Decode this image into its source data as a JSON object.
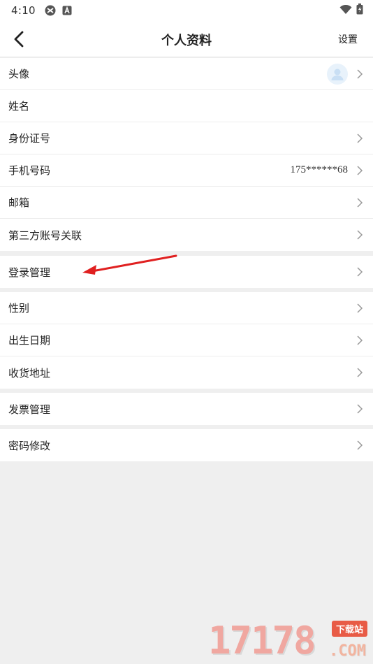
{
  "status_bar": {
    "time": "4:10",
    "icons_left": [
      "sync-icon",
      "app-a-icon"
    ],
    "icons_right": [
      "wifi-icon",
      "battery-icon"
    ]
  },
  "header": {
    "title": "个人资料",
    "settings_label": "设置",
    "back_icon": "chevron-left-icon"
  },
  "groups": [
    [
      {
        "label": "头像",
        "value": "",
        "has_avatar": true
      },
      {
        "label": "姓名",
        "value": "",
        "has_chevron": false
      },
      {
        "label": "身份证号",
        "value": ""
      },
      {
        "label": "手机号码",
        "value": "175******68"
      },
      {
        "label": "邮箱",
        "value": ""
      },
      {
        "label": "第三方账号关联",
        "value": ""
      }
    ],
    [
      {
        "label": "登录管理",
        "value": ""
      }
    ],
    [
      {
        "label": "性别",
        "value": ""
      },
      {
        "label": "出生日期",
        "value": ""
      },
      {
        "label": "收货地址",
        "value": ""
      }
    ],
    [
      {
        "label": "发票管理",
        "value": ""
      }
    ],
    [
      {
        "label": "密码修改",
        "value": ""
      }
    ]
  ],
  "annotation": {
    "color": "#e02020",
    "icon": "red-arrow-pointer"
  },
  "watermark": {
    "digits": "17178",
    "tag": "下载站",
    "suffix": ".COM"
  },
  "colors": {
    "background": "#efefef",
    "surface": "#ffffff",
    "chevron": "#9a9a9a"
  }
}
